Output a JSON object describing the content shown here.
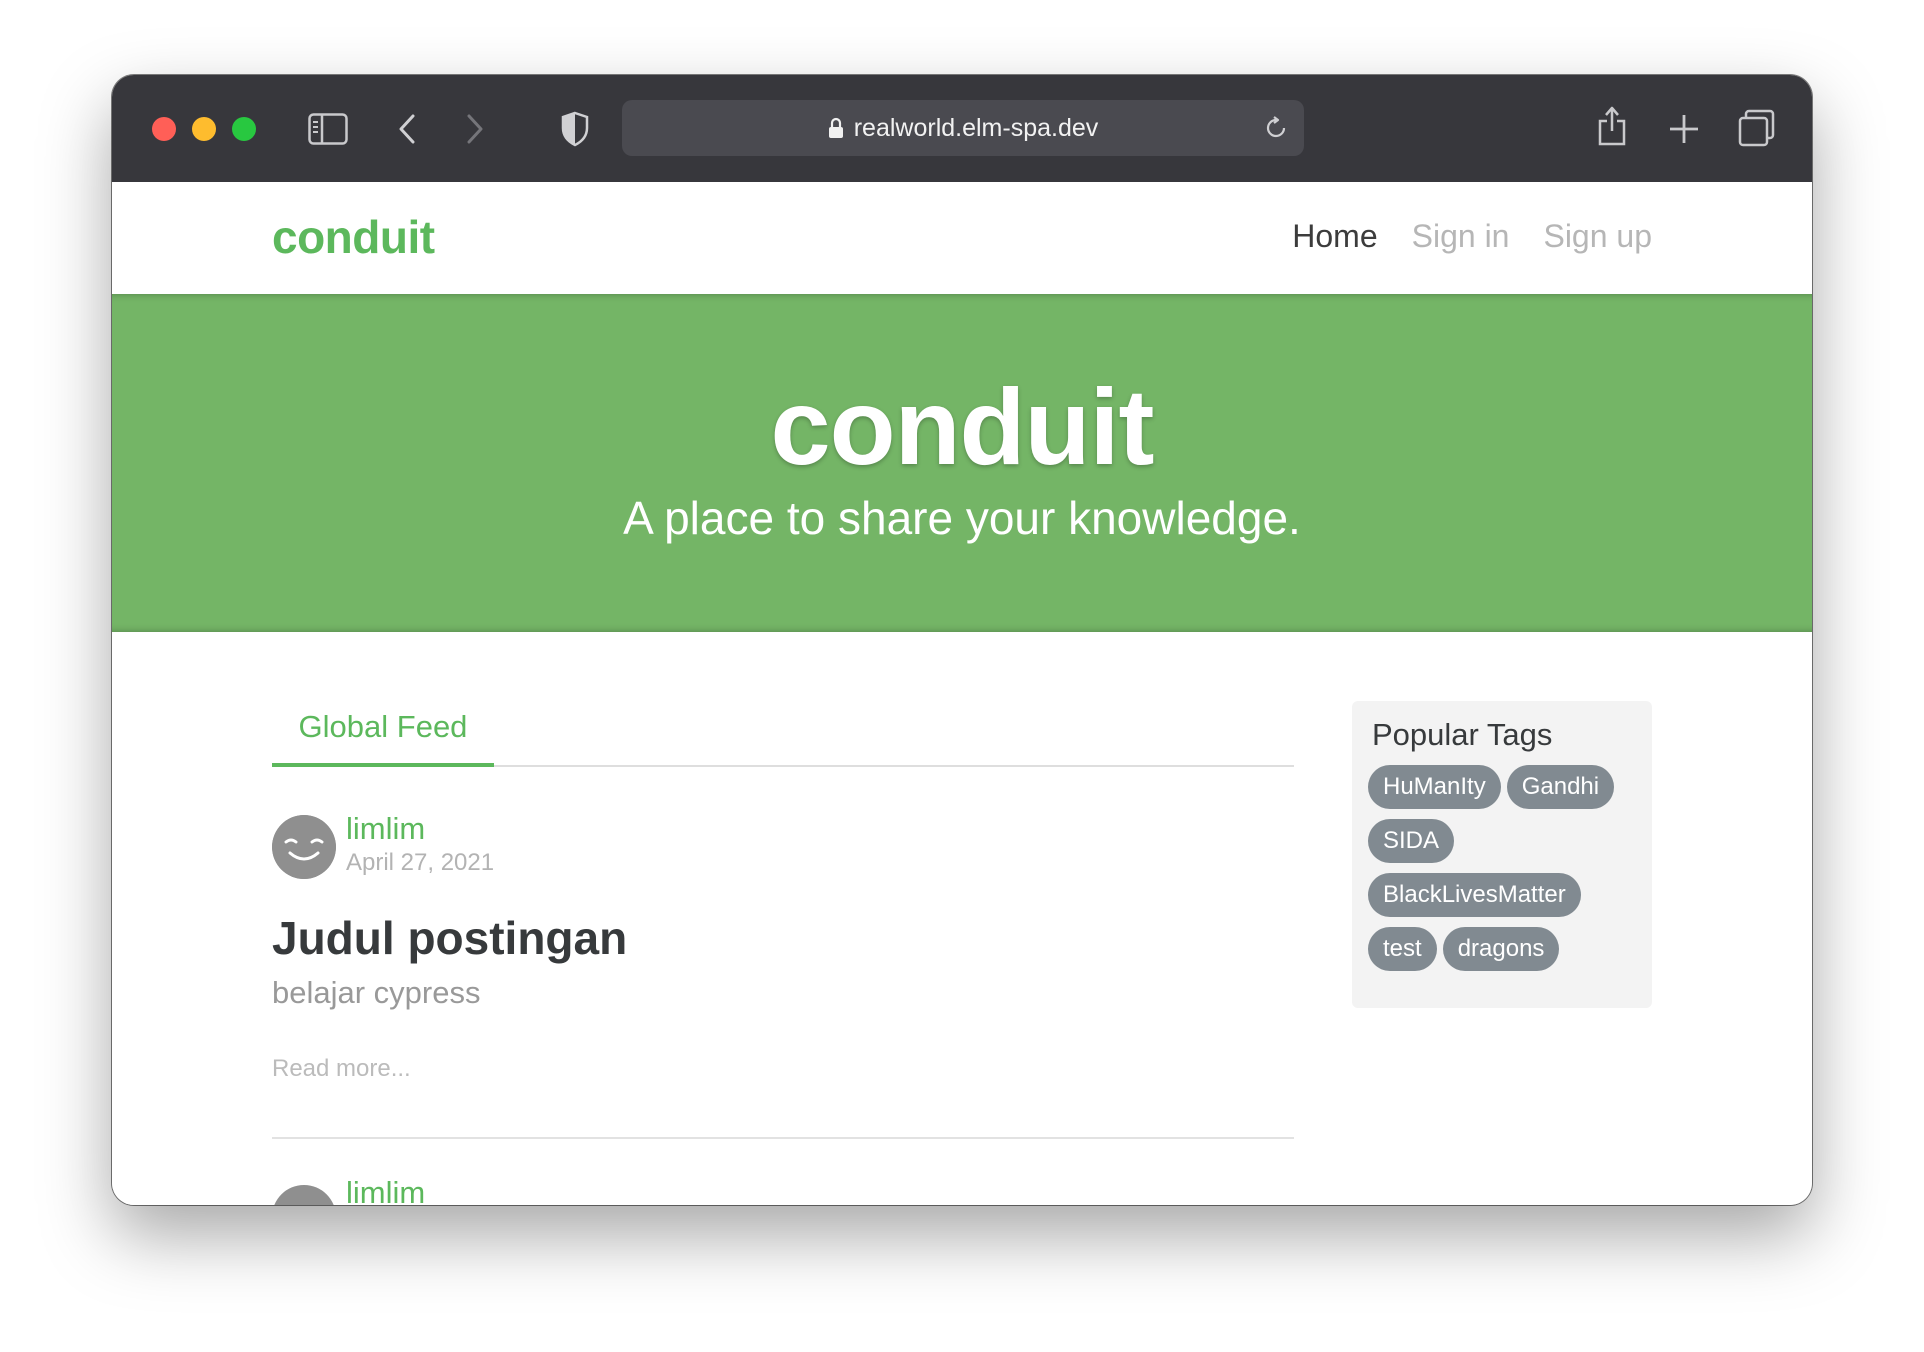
{
  "browser": {
    "url": "realworld.elm-spa.dev",
    "icons": [
      "sidebar-icon",
      "back-icon",
      "forward-icon",
      "shield-icon",
      "lock-icon",
      "reload-icon",
      "share-icon",
      "new-tab-icon",
      "tabs-overview-icon"
    ]
  },
  "navbar": {
    "brand": "conduit",
    "links": [
      {
        "label": "Home"
      },
      {
        "label": "Sign in"
      },
      {
        "label": "Sign up"
      }
    ]
  },
  "banner": {
    "title": "conduit",
    "tagline": "A place to share your knowledge."
  },
  "feed": {
    "tab": "Global Feed",
    "articles": [
      {
        "author": "limlim",
        "date": "April 27, 2021",
        "title": "Judul postingan",
        "description": "belajar cypress",
        "read_more": "Read more..."
      },
      {
        "author": "limlim"
      }
    ]
  },
  "sidebar": {
    "heading": "Popular Tags",
    "tags": [
      "HuManIty",
      "Gandhi",
      "SIDA",
      "BlackLivesMatter",
      "test",
      "dragons"
    ]
  },
  "colors": {
    "brand_green": "#5cb85c",
    "banner_green": "#74b566",
    "tag_gray": "#818a91",
    "toolbar": "#37373c"
  }
}
